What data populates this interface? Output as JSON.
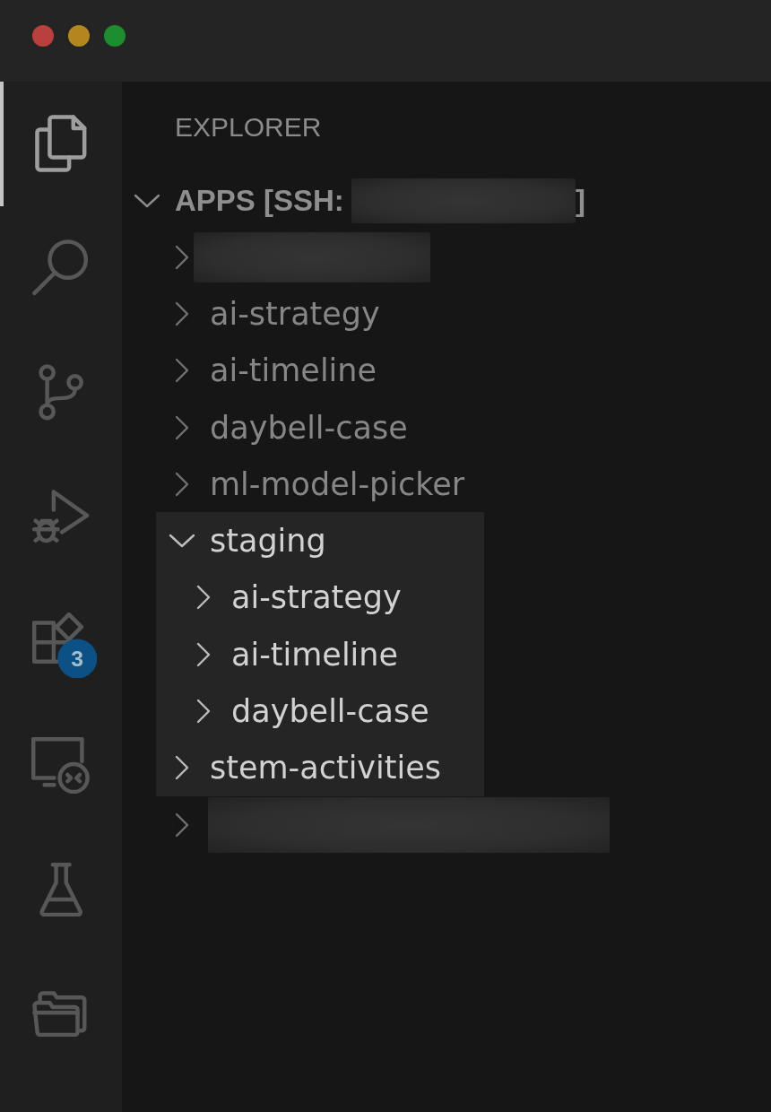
{
  "activity_bar": {
    "items": [
      {
        "selected": true
      },
      {
        "selected": false
      },
      {
        "selected": false
      },
      {
        "selected": false
      },
      {
        "selected": false,
        "badge": "3"
      },
      {
        "selected": false
      },
      {
        "selected": false
      },
      {
        "selected": false
      }
    ]
  },
  "explorer": {
    "title": "EXPLORER",
    "root": {
      "label": "APPS [SSH:",
      "redacted": true,
      "label_end": "]",
      "expanded": true,
      "children": [
        {
          "redacted": true,
          "expanded": false,
          "highlighted": false
        },
        {
          "label": "ai-strategy",
          "redacted": false,
          "expanded": false,
          "highlighted": false
        },
        {
          "label": "ai-timeline",
          "redacted": false,
          "expanded": false,
          "highlighted": false
        },
        {
          "label": "daybell-case",
          "redacted": false,
          "expanded": false,
          "highlighted": false
        },
        {
          "label": "ml-model-picker",
          "redacted": false,
          "expanded": false,
          "highlighted": false
        },
        {
          "label": "staging",
          "redacted": false,
          "expanded": true,
          "highlighted": true,
          "children": [
            {
              "label": "ai-strategy",
              "redacted": false,
              "expanded": false,
              "highlighted": true
            },
            {
              "label": "ai-timeline",
              "redacted": false,
              "expanded": false,
              "highlighted": true
            },
            {
              "label": "daybell-case",
              "redacted": false,
              "expanded": false,
              "highlighted": true
            }
          ]
        },
        {
          "label": "stem-activities",
          "redacted": false,
          "expanded": false,
          "highlighted": true
        },
        {
          "redacted": true,
          "expanded": false,
          "highlighted": false
        }
      ]
    }
  }
}
